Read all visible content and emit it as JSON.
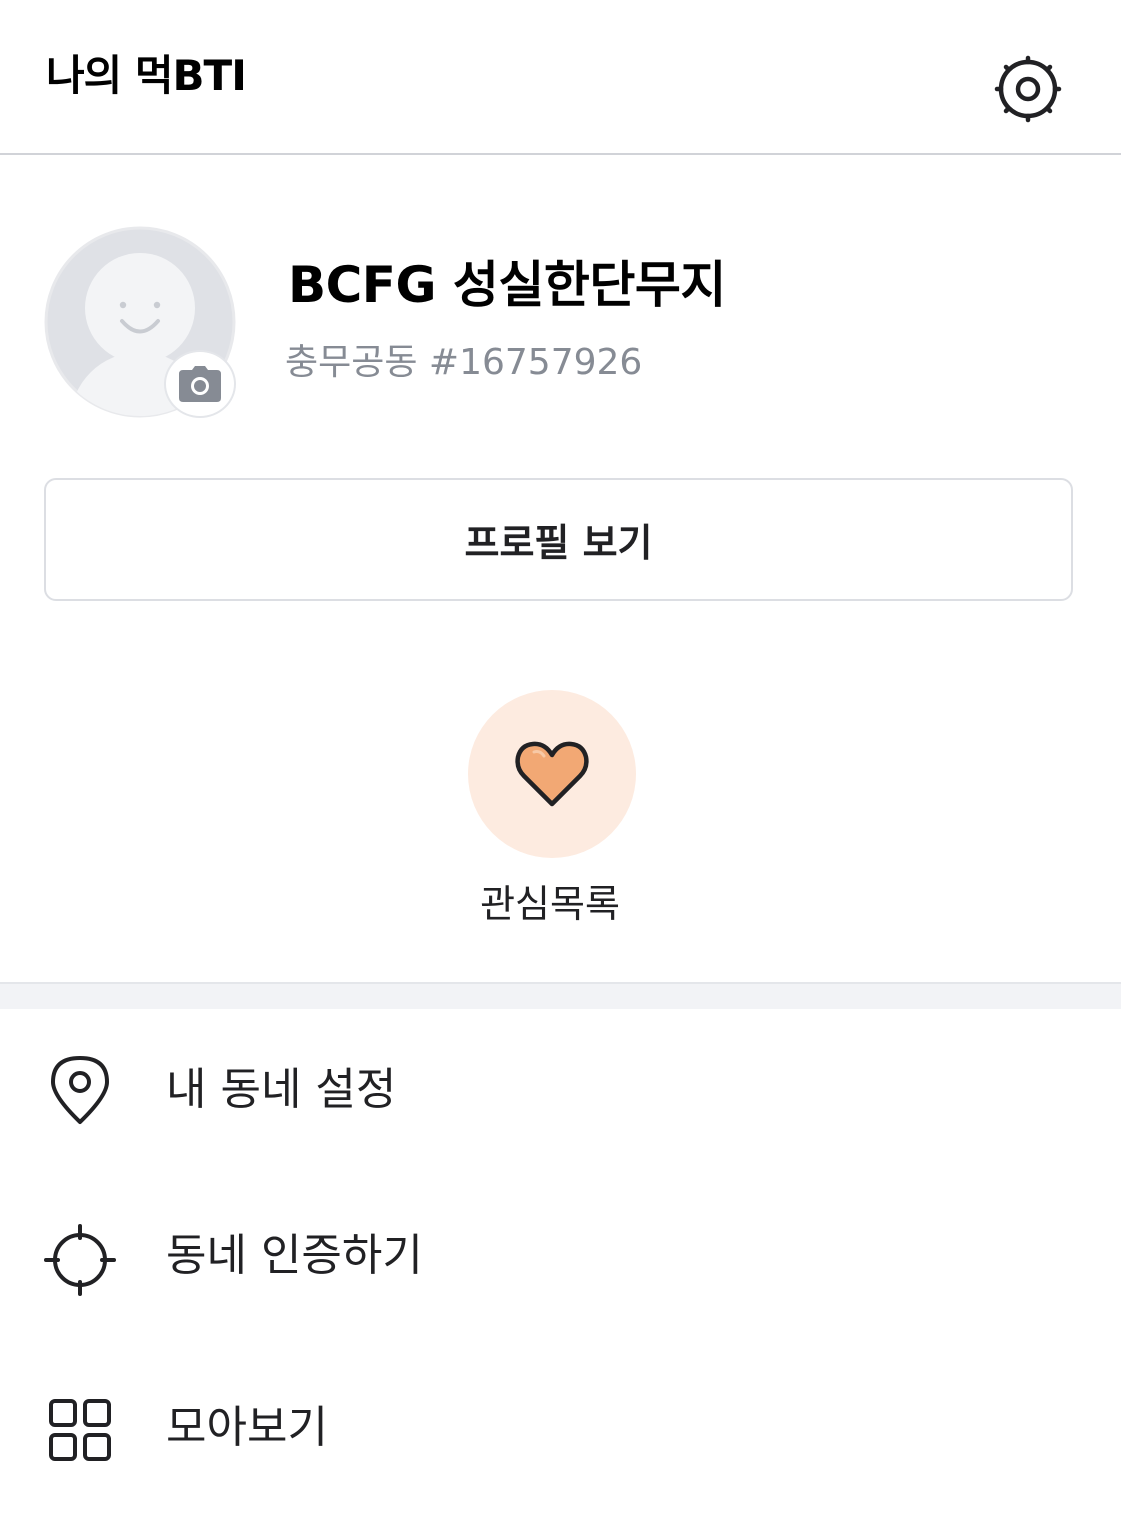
{
  "header": {
    "title": "나의 먹BTI",
    "settings_icon": "gear-icon"
  },
  "profile": {
    "name": "BCFG 성실한단무지",
    "location_id": "충무공동 #16757926",
    "avatar_icon": "default-avatar-icon",
    "camera_icon": "camera-icon",
    "view_profile_label": "프로필 보기"
  },
  "favorites": {
    "label": "관심목록",
    "icon": "heart-icon",
    "colors": {
      "circle": "#fdebe0",
      "heart_fill": "#f2a874",
      "heart_stroke": "#212124"
    }
  },
  "menu": {
    "items": [
      {
        "label": "내 동네 설정",
        "icon": "location-pin-icon"
      },
      {
        "label": "동네 인증하기",
        "icon": "crosshair-icon"
      },
      {
        "label": "모아보기",
        "icon": "grid-icon"
      }
    ]
  }
}
